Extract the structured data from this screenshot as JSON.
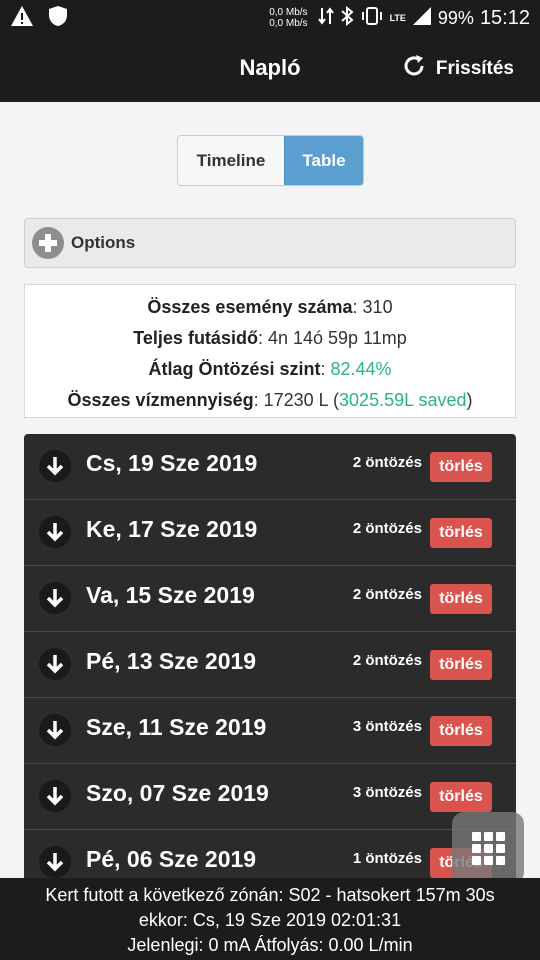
{
  "status_bar": {
    "speed_up": "0,0 Mb/s",
    "speed_down": "0,0 Mb/s",
    "lte": "LTE",
    "battery": "99%",
    "time": "15:12"
  },
  "header": {
    "title": "Napló",
    "refresh_label": "Frissítés"
  },
  "view_toggle": {
    "timeline_label": "Timeline",
    "table_label": "Table",
    "active": "Table"
  },
  "options": {
    "label": "Options"
  },
  "stats": {
    "events_label": "Összes esemény száma",
    "events_value": "310",
    "runtime_label": "Teljes futásidő",
    "runtime_value": "4n 14ó 59p 11mp",
    "avg_label": "Átlag Öntözési szint",
    "avg_value": "82.44%",
    "water_label": "Összes vízmennyiség",
    "water_value": "17230 L",
    "saved_value": "3025.59L saved"
  },
  "log_items": [
    {
      "date": "Cs, 19 Sze 2019",
      "count": "2 öntözés",
      "delete_label": "törlés"
    },
    {
      "date": "Ke, 17 Sze 2019",
      "count": "2 öntözés",
      "delete_label": "törlés"
    },
    {
      "date": "Va, 15 Sze 2019",
      "count": "2 öntözés",
      "delete_label": "törlés"
    },
    {
      "date": "Pé, 13 Sze 2019",
      "count": "2 öntözés",
      "delete_label": "törlés"
    },
    {
      "date": "Sze, 11 Sze 2019",
      "count": "3 öntözés",
      "delete_label": "törlés"
    },
    {
      "date": "Szo, 07 Sze 2019",
      "count": "3 öntözés",
      "delete_label": "törlés"
    },
    {
      "date": "Pé, 06 Sze 2019",
      "count": "1 öntözés",
      "delete_label": "törlés"
    }
  ],
  "footer": {
    "line1": "Kert futott a következő zónán: S02 - hatsokert 157m 30s",
    "line2": "ekkor: Cs, 19 Sze 2019 02:01:31",
    "line3": "Jelenlegi: 0 mA  Átfolyás: 0.00 L/min"
  },
  "colors": {
    "accent": "#5a9fd0",
    "danger": "#d9534f",
    "success": "#2bb28a",
    "dark": "#1c1c1c"
  }
}
